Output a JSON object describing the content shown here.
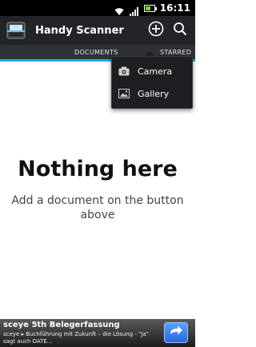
{
  "status_bar": {
    "time": "16:11",
    "battery_level": 0.6,
    "battery_color": "#7bd12a"
  },
  "action_bar": {
    "title": "Handy Scanner",
    "app_icon": "scanner-app-icon",
    "add_icon": "add-icon",
    "search_icon": "search-icon",
    "background": "#222428"
  },
  "tabs": {
    "items": [
      {
        "label": "DOCUMENTS"
      },
      {
        "label": "STARRED"
      }
    ],
    "indicator_color": "#2aa6e0"
  },
  "empty_state": {
    "title": "Nothing here",
    "subtitle": "Add a document on the button above"
  },
  "popup_menu": {
    "items": [
      {
        "label": "Camera",
        "icon": "camera-icon"
      },
      {
        "label": "Gallery",
        "icon": "gallery-icon"
      }
    ]
  },
  "ad": {
    "title": "sceye 5th Belegerfassung",
    "text": "sceye ▸ Buchführung mit Zukunft – die Lösung - \"Ja\" sagt auch DATE...",
    "button_icon": "arrow-forward-icon"
  }
}
